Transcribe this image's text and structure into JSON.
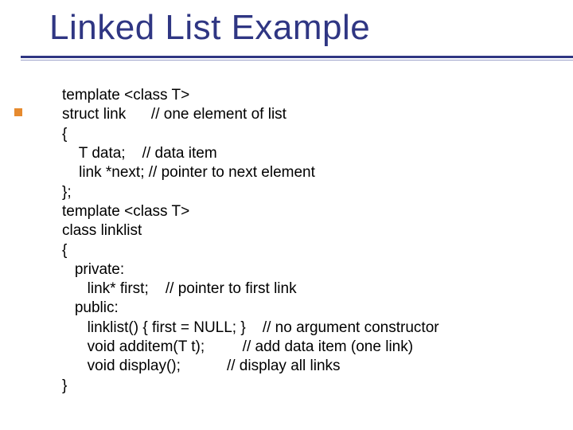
{
  "title": "Linked List Example",
  "code": {
    "l1": "template <class T>",
    "l2": "struct link      // one element of list",
    "l3": "{",
    "l4": "    T data;    // data item",
    "l5": "    link *next; // pointer to next element",
    "l6": "};",
    "l7": "template <class T>",
    "l8": "class linklist",
    "l9": "{",
    "l10": "   private:",
    "l11": "      link* first;    // pointer to first link",
    "l12": "   public:",
    "l13": "      linklist() { first = NULL; }    // no argument constructor",
    "l14": "      void additem(T t);         // add data item (one link)",
    "l15": "      void display();           // display all links",
    "l16": "}"
  }
}
